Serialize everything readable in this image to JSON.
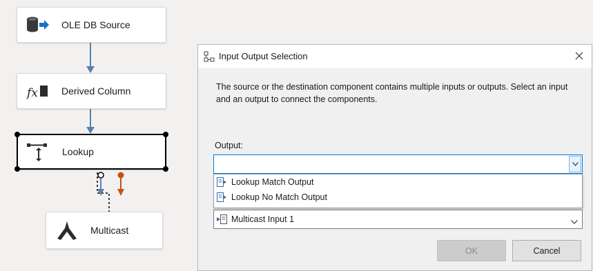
{
  "canvas": {
    "components": {
      "ole_db_source": "OLE DB Source",
      "derived_column": "Derived Column",
      "lookup": "Lookup",
      "multicast": "Multicast"
    },
    "colors": {
      "path_blue": "#5a7fb0",
      "path_error_red": "#c94f16",
      "selection_border": "#000000"
    }
  },
  "dialog": {
    "title": "Input Output Selection",
    "description": "The source or the destination component contains multiple inputs or outputs. Select an input and an output to connect the components.",
    "output_label": "Output:",
    "output_value": "",
    "output_options": [
      "Lookup Match Output",
      "Lookup No Match Output"
    ],
    "input_value": "Multicast Input 1",
    "ok_label": "OK",
    "cancel_label": "Cancel",
    "colors": {
      "focus_border": "#0078d7",
      "body_background": "#f0f0f0"
    }
  }
}
